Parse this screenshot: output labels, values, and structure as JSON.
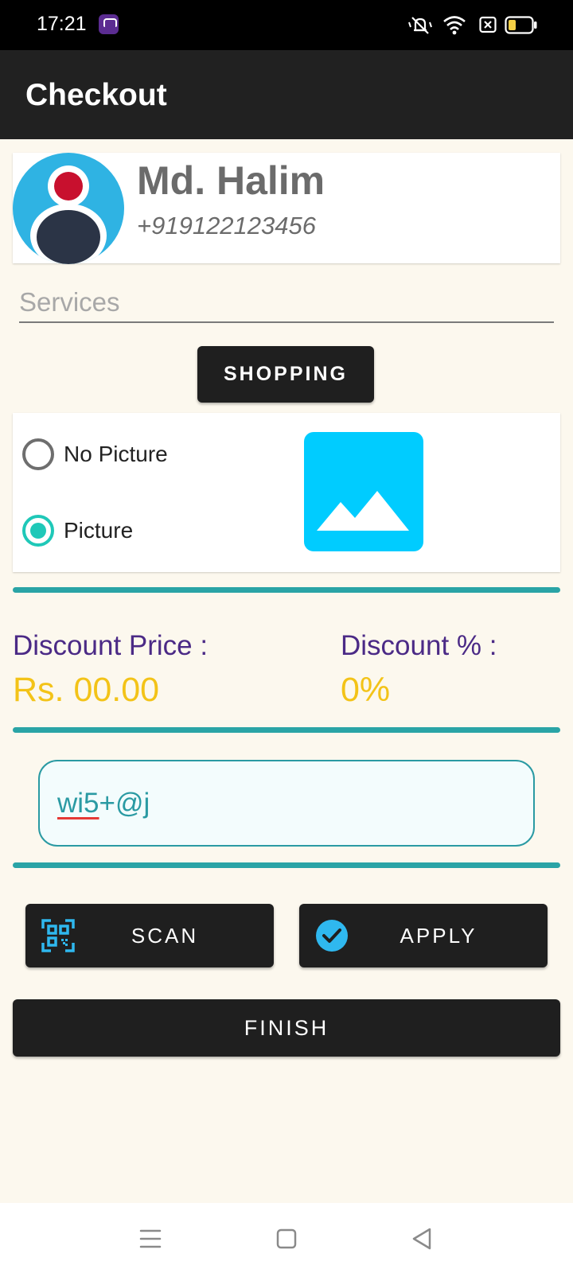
{
  "status_bar": {
    "time": "17:21",
    "icons": [
      "app-notification-icon",
      "vibrate-mute-icon",
      "wifi-icon",
      "sim-x-icon",
      "battery-low-icon"
    ]
  },
  "app_bar": {
    "title": "Checkout"
  },
  "profile": {
    "name": "Md. Halim",
    "phone": "+919122123456",
    "avatar_icon": "user-avatar-icon",
    "colors": {
      "circle": "#2fb3e3",
      "head": "#c8102e",
      "body": "#2b3446"
    }
  },
  "services": {
    "placeholder": "Services",
    "value": ""
  },
  "shopping_button": {
    "label": "SHOPPING"
  },
  "picture_options": {
    "options": [
      {
        "label": "No Picture",
        "selected": false
      },
      {
        "label": "Picture",
        "selected": true
      }
    ],
    "image_icon": "image-placeholder-icon"
  },
  "discount": {
    "price_label": "Discount Price :",
    "price_value": "Rs. 00.00",
    "percent_label": "Discount % :",
    "percent_value": "0%"
  },
  "coupon": {
    "value_underlined": "wi5",
    "value_rest": "+@j"
  },
  "scan_button": {
    "label": "SCAN",
    "icon": "qr-scan-icon"
  },
  "apply_button": {
    "label": "APPLY",
    "icon": "check-circle-icon"
  },
  "finish_button": {
    "label": "FINISH"
  },
  "nav_bar": {
    "icons": [
      "menu-icon",
      "home-icon",
      "back-icon"
    ]
  },
  "colors": {
    "background": "#fcf8ee",
    "app_bar": "#212121",
    "accent_teal": "#2aa4a6",
    "discount_label": "#4b2a86",
    "discount_value": "#f3c318",
    "image_bg": "#00ccff",
    "radio_selected": "#1fc8b8"
  }
}
